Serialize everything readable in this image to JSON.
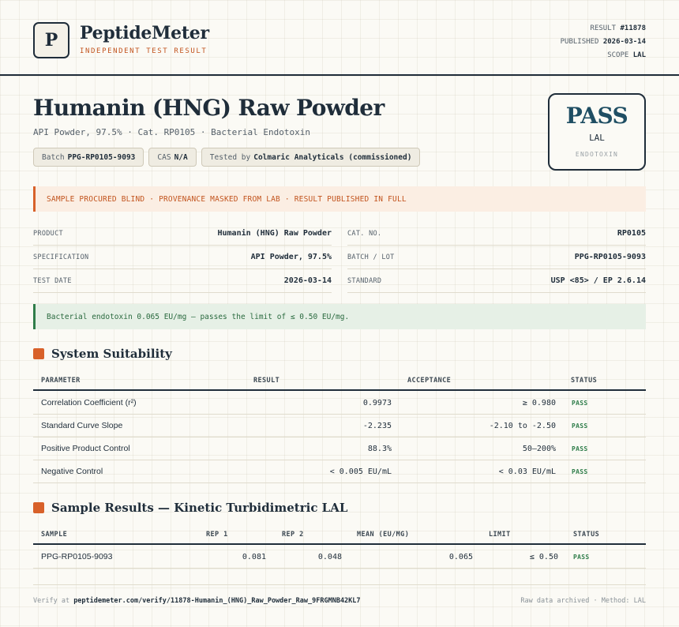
{
  "header": {
    "logo_letter": "P",
    "brand": "PeptideMeter",
    "brand_sub": "INDEPENDENT TEST RESULT",
    "result_label": "RESULT",
    "result_value": "#11878",
    "published_label": "PUBLISHED",
    "published_value": "2026-03-14",
    "scope_label": "SCOPE",
    "scope_value": "LAL"
  },
  "product": {
    "title": "Humanin (HNG) Raw Powder",
    "subtitle": "API Powder, 97.5% · Cat. RP0105 · Bacterial Endotoxin",
    "chips": [
      {
        "label": "Batch",
        "value": "PPG-RP0105-9093"
      },
      {
        "label": "CAS",
        "value": "N/A"
      },
      {
        "label": "Tested by",
        "value": "Colmaric Analyticals (commissioned)"
      }
    ]
  },
  "verdict": {
    "word": "PASS",
    "method": "LAL",
    "category": "ENDOTOXIN"
  },
  "notice": "SAMPLE PROCURED BLIND · PROVENANCE MASKED FROM LAB · RESULT PUBLISHED IN FULL",
  "info": {
    "left": [
      {
        "label": "PRODUCT",
        "value": "Humanin (HNG) Raw Powder"
      },
      {
        "label": "SPECIFICATION",
        "value": "API Powder, 97.5%"
      },
      {
        "label": "TEST DATE",
        "value": "2026-03-14"
      }
    ],
    "right": [
      {
        "label": "CAT. NO.",
        "value": "RP0105"
      },
      {
        "label": "BATCH / LOT",
        "value": "PPG-RP0105-9093"
      },
      {
        "label": "STANDARD",
        "value": "USP <85> / EP 2.6.14"
      }
    ]
  },
  "result_note": "Bacterial endotoxin 0.065 EU/mg — passes the limit of ≤ 0.50 EU/mg.",
  "suitability": {
    "title": "System Suitability",
    "headers": [
      "PARAMETER",
      "RESULT",
      "ACCEPTANCE",
      "STATUS"
    ],
    "rows": [
      {
        "parameter": "Correlation Coefficient (r²)",
        "result": "0.9973",
        "acceptance": "≥ 0.980",
        "status": "PASS"
      },
      {
        "parameter": "Standard Curve Slope",
        "result": "-2.235",
        "acceptance": "-2.10 to -2.50",
        "status": "PASS"
      },
      {
        "parameter": "Positive Product Control",
        "result": "88.3%",
        "acceptance": "50–200%",
        "status": "PASS"
      },
      {
        "parameter": "Negative Control",
        "result": "< 0.005 EU/mL",
        "acceptance": "< 0.03 EU/mL",
        "status": "PASS"
      }
    ]
  },
  "samples": {
    "title": "Sample Results — Kinetic Turbidimetric LAL",
    "headers": [
      "SAMPLE",
      "REP 1",
      "REP 2",
      "MEAN (EU/MG)",
      "LIMIT",
      "STATUS"
    ],
    "rows": [
      {
        "sample": "PPG-RP0105-9093",
        "rep1": "0.081",
        "rep2": "0.048",
        "mean": "0.065",
        "limit": "≤ 0.50",
        "status": "PASS"
      }
    ]
  },
  "footer": {
    "verify_prefix": "Verify at",
    "verify_url": "peptidemeter.com/verify/11878-Humanin_(HNG)_Raw_Powder_Raw_9FRGMNB42KL7",
    "archive_note": "Raw data archived · Method: LAL"
  },
  "colors": {
    "ink": "#1f2d3a",
    "accent": "#d8612a",
    "pass_green": "#2f7d4a",
    "verdict_blue": "#1f4e63"
  }
}
